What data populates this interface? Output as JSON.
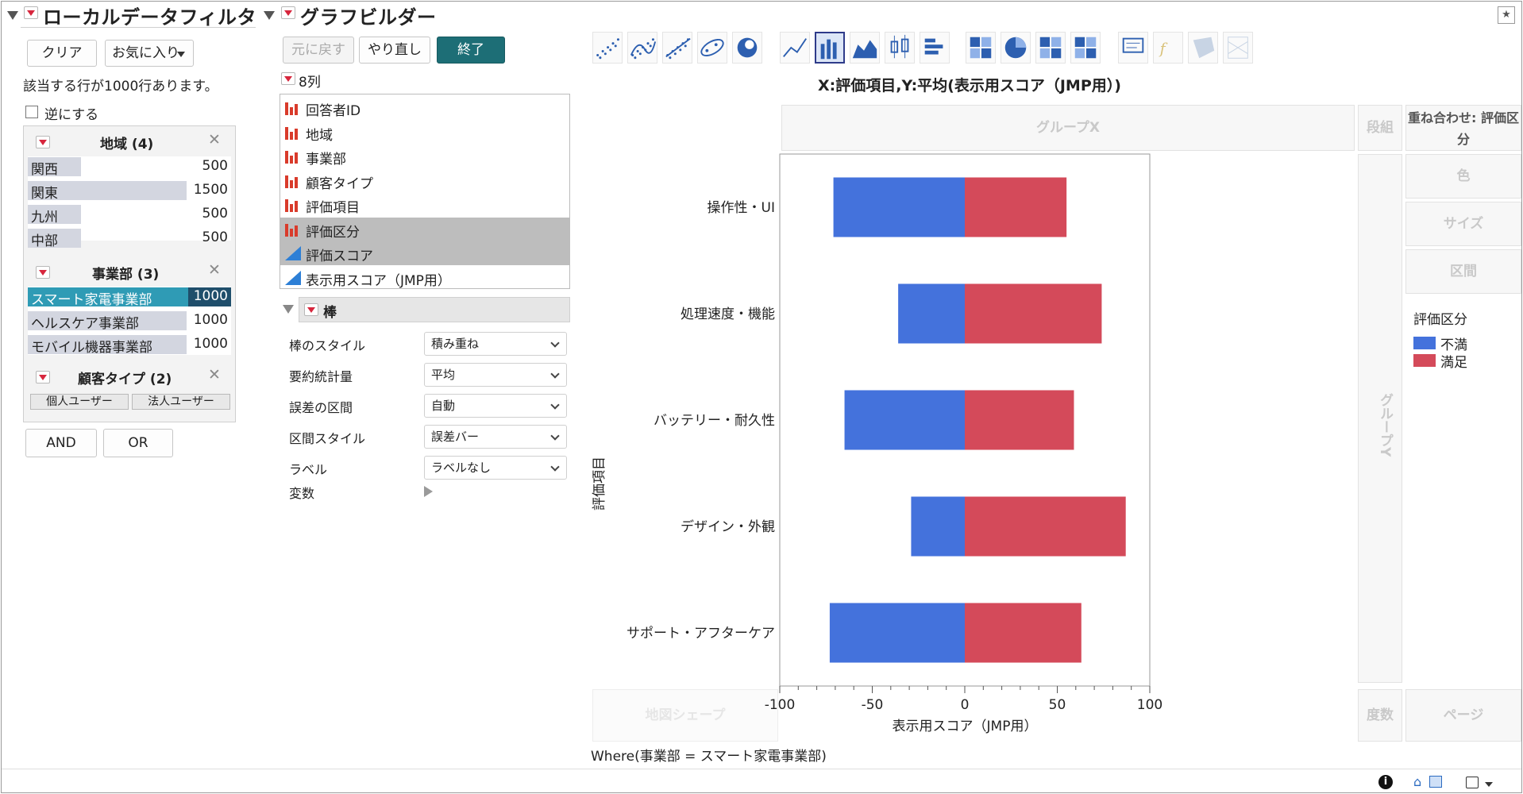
{
  "filter": {
    "title": "ローカルデータフィルタ",
    "clear_label": "クリア",
    "favorites_label": "お気に入り",
    "matching_rows": "該当する行が1000行あります。",
    "invert_label": "逆にする",
    "groups": [
      {
        "title": "地域 (4)",
        "items": [
          {
            "label": "関西",
            "count": "500",
            "fraction": 0.333
          },
          {
            "label": "関東",
            "count": "1500",
            "fraction": 1.0
          },
          {
            "label": "九州",
            "count": "500",
            "fraction": 0.333
          },
          {
            "label": "中部",
            "count": "500",
            "fraction": 0.333
          }
        ]
      },
      {
        "title": "事業部 (3)",
        "items": [
          {
            "label": "スマート家電事業部",
            "count": "1000",
            "fraction": 1.0,
            "selected": true
          },
          {
            "label": "ヘルスケア事業部",
            "count": "1000",
            "fraction": 1.0
          },
          {
            "label": "モバイル機器事業部",
            "count": "1000",
            "fraction": 1.0
          }
        ]
      },
      {
        "title": "顧客タイプ (2)",
        "buttons": [
          "個人ユーザー",
          "法人ユーザー"
        ]
      }
    ],
    "and_label": "AND",
    "or_label": "OR"
  },
  "builder": {
    "title": "グラフビルダー",
    "undo_label": "元に戻す",
    "redo_label": "やり直し",
    "done_label": "終了",
    "columns_header": "8列",
    "columns": [
      {
        "label": "回答者ID",
        "type": "nominal",
        "highlight": false
      },
      {
        "label": "地域",
        "type": "nominal",
        "highlight": false
      },
      {
        "label": "事業部",
        "type": "nominal",
        "highlight": false
      },
      {
        "label": "顧客タイプ",
        "type": "nominal",
        "highlight": false
      },
      {
        "label": "評価項目",
        "type": "nominal",
        "highlight": false
      },
      {
        "label": "評価区分",
        "type": "nominal",
        "highlight": true
      },
      {
        "label": "評価スコア",
        "type": "continuous",
        "highlight": true
      },
      {
        "label": "表示用スコア（JMP用）",
        "type": "continuous",
        "highlight": false
      }
    ],
    "element_title": "棒",
    "props": [
      {
        "label": "棒のスタイル",
        "value": "積み重ね"
      },
      {
        "label": "要約統計量",
        "value": "平均"
      },
      {
        "label": "誤差の区間",
        "value": "自動"
      },
      {
        "label": "区間スタイル",
        "value": "誤差バー"
      },
      {
        "label": "ラベル",
        "value": "ラベルなし"
      }
    ],
    "variables_label": "変数",
    "zones": {
      "group_x": "グループX",
      "wrap": "段組",
      "overlay": "重ね合わせ: 評価区分",
      "color": "色",
      "size": "サイズ",
      "interval": "区間",
      "group_y": "グループY",
      "map_shape": "地図シェープ",
      "freq": "度数",
      "page": "ページ"
    },
    "where_text": "Where(事業部 = スマート家電事業部)"
  },
  "chart_data": {
    "type": "bar",
    "orientation": "horizontal",
    "stacked": true,
    "title": "X:評価項目,Y:平均(表示用スコア（JMP用）)",
    "xlabel": "表示用スコア（JMP用）",
    "ylabel": "評価項目",
    "xlim": [
      -100,
      100
    ],
    "xticks": [
      -100,
      -50,
      0,
      50,
      100
    ],
    "categories": [
      "操作性・UI",
      "処理速度・機能",
      "バッテリー・耐久性",
      "デザイン・外観",
      "サポート・アフターケア"
    ],
    "series": [
      {
        "name": "不満",
        "color": "#4472dc",
        "values": [
          -71,
          -36,
          -65,
          -29,
          -73
        ]
      },
      {
        "name": "満足",
        "color": "#d44a5a",
        "values": [
          55,
          74,
          59,
          87,
          63
        ]
      }
    ],
    "legend_title": "評価区分",
    "legend_position": "right",
    "grid": false
  }
}
